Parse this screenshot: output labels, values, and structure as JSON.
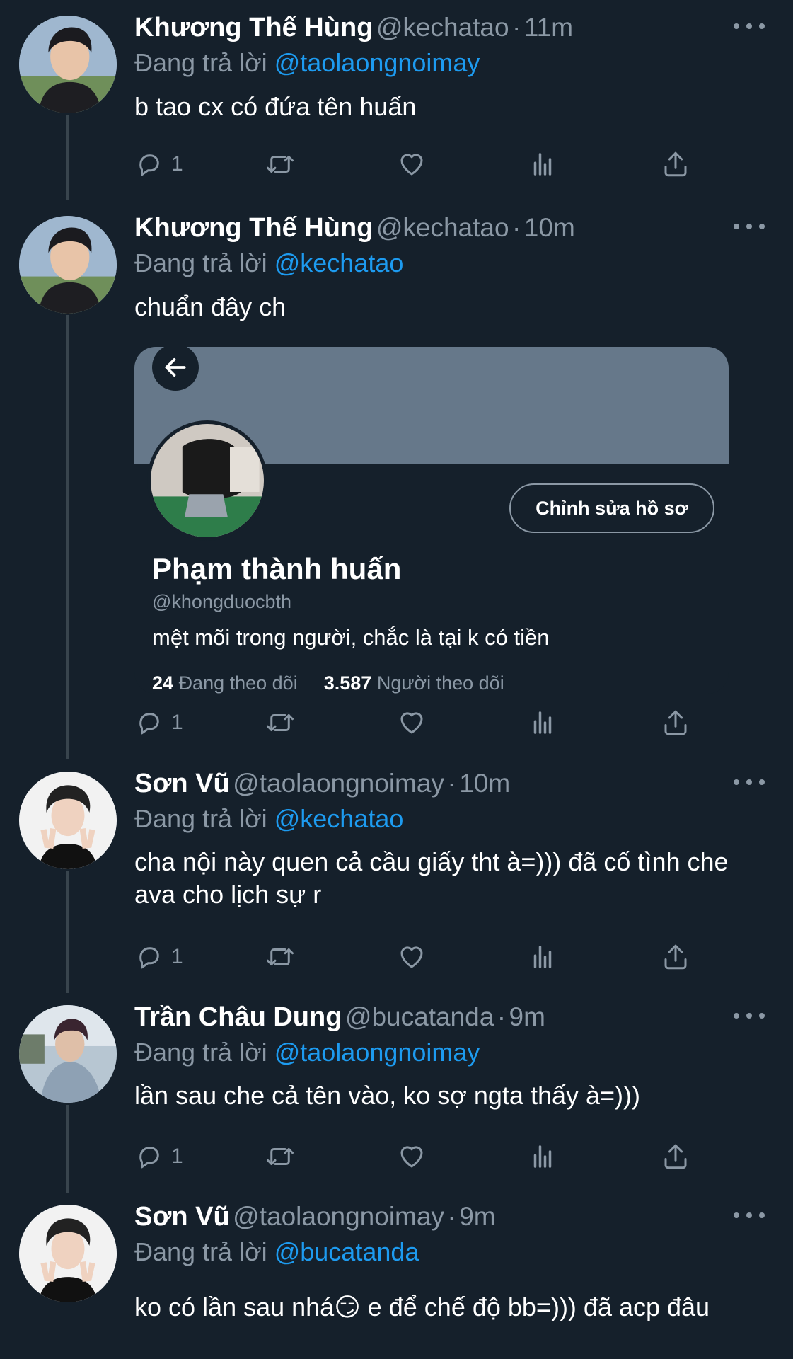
{
  "tweets": [
    {
      "name": "Khương Thế Hùng",
      "handle": "@kechatao",
      "time": "11m",
      "replying_label": "Đang trả lời",
      "mention": "@taolaongnoimay",
      "text": "b tao cx có đứa tên huấn",
      "reply_count": "1"
    },
    {
      "name": "Khương Thế Hùng",
      "handle": "@kechatao",
      "time": "10m",
      "replying_label": "Đang trả lời",
      "mention": "@kechatao",
      "text": "chuẩn đây ch",
      "reply_count": "1"
    },
    {
      "name": "Sơn Vũ",
      "handle": "@taolaongnoimay",
      "time": "10m",
      "replying_label": "Đang trả lời",
      "mention": "@kechatao",
      "text": "cha nội này quen cả cầu giấy tht à=))) đã cố tình che ava cho lịch sự r",
      "reply_count": "1"
    },
    {
      "name": "Trần Châu Dung",
      "handle": "@bucatanda",
      "time": "9m",
      "replying_label": "Đang trả lời",
      "mention": "@taolaongnoimay",
      "text": "lần sau che cả tên vào, ko sợ ngta thấy à=)))",
      "reply_count": "1"
    },
    {
      "name": "Sơn Vũ",
      "handle": "@taolaongnoimay",
      "time": "9m",
      "replying_label": "Đang trả lời",
      "mention": "@bucatanda",
      "text": "ko có lần sau nhá😏  e để chế độ bb=))) đã acp đâu"
    }
  ],
  "profile_card": {
    "name": "Phạm thành huấn",
    "handle": "@khongduocbth",
    "bio": "mệt mõi trong người, chắc là tại k có tiền",
    "edit_button": "Chỉnh sửa hồ sơ",
    "following_count": "24",
    "following_label": "Đang theo dõi",
    "followers_count": "3.587",
    "followers_label": "Người theo dõi"
  },
  "icons": {
    "reply": "reply-icon",
    "retweet": "retweet-icon",
    "like": "heart-icon",
    "analytics": "analytics-icon",
    "share": "share-icon",
    "more": "more-dots-icon",
    "back": "back-arrow-icon"
  },
  "colors": {
    "background": "#15202b",
    "mention": "#1d9bf0",
    "secondary_text": "#8b98a5",
    "banner": "#66788a"
  }
}
